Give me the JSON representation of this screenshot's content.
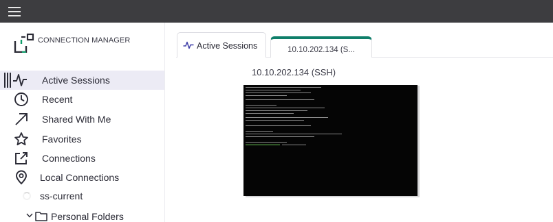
{
  "app": {
    "brand": "CONNECTION MANAGER",
    "accent_color": "#0f7f6a",
    "topbar_color": "#3d3d40"
  },
  "topbar": {
    "menu_icon": "hamburger-menu-icon"
  },
  "sidebar": {
    "items": [
      {
        "label": "Active Sessions",
        "icon": "activity-pulse-icon",
        "active": true
      },
      {
        "label": "Recent",
        "icon": "clock-icon"
      },
      {
        "label": "Shared With Me",
        "icon": "arrow-up-right-icon"
      },
      {
        "label": "Favorites",
        "icon": "star-icon"
      },
      {
        "label": "Connections",
        "icon": "external-link-icon"
      },
      {
        "label": "Local Connections",
        "icon": "location-pin-icon"
      }
    ],
    "current_vault": "ss-current",
    "folder": {
      "label": "Personal Folders",
      "expanded": true,
      "icon": "folder-icon"
    }
  },
  "tabs": [
    {
      "label": "Active Sessions",
      "icon": "activity-pulse-icon"
    },
    {
      "label": "10.10.202.134 (S...",
      "selected": true
    }
  ],
  "session": {
    "title": "10.10.202.134 (SSH)"
  }
}
